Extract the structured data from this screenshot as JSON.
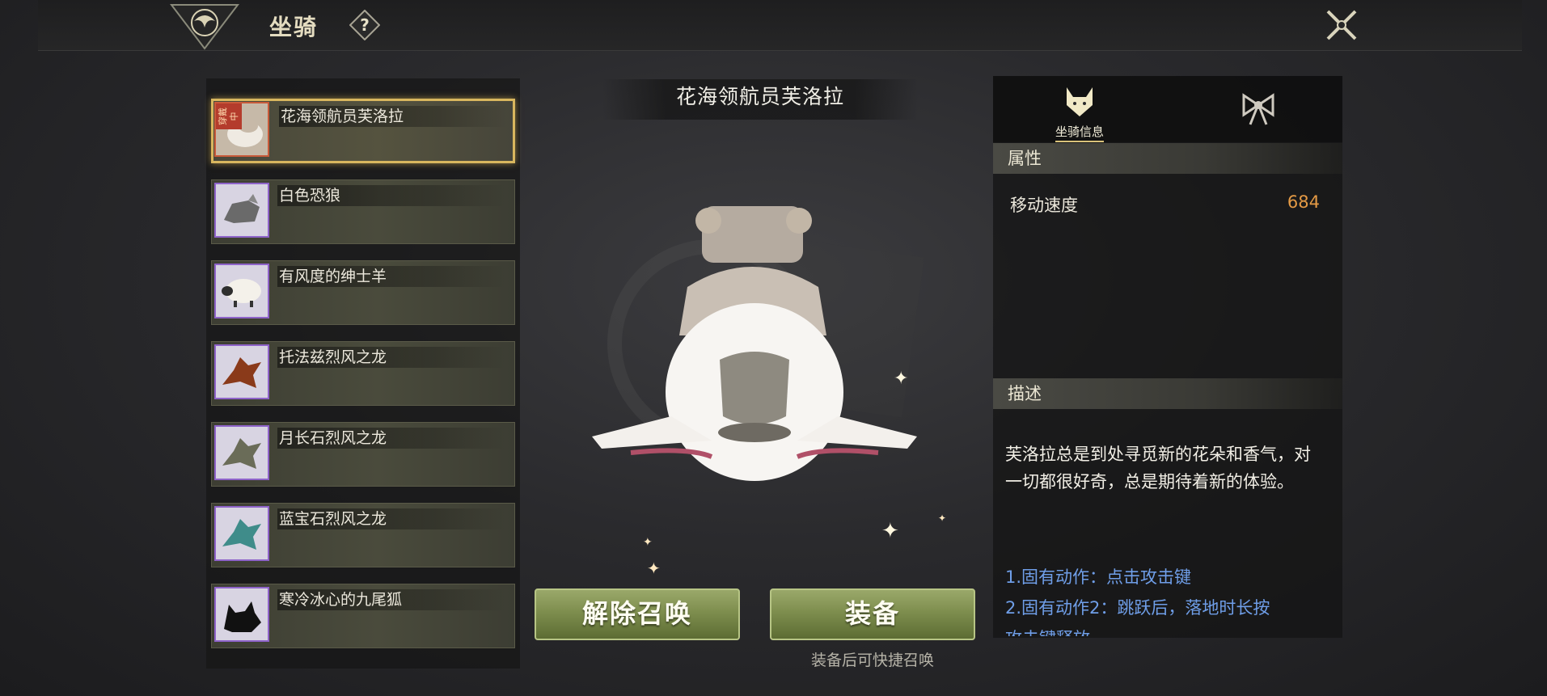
{
  "header": {
    "title": "坐骑",
    "help_icon": "question-icon",
    "close_icon": "close-icon"
  },
  "mount_list": [
    {
      "name": "花海领航员芙洛拉",
      "selected": true,
      "badge": "穿戴中",
      "frame_color": "#c85a3a"
    },
    {
      "name": "白色恐狼",
      "selected": false,
      "frame_color": "#8e63c9"
    },
    {
      "name": "有风度的绅士羊",
      "selected": false,
      "frame_color": "#8e63c9"
    },
    {
      "name": "托法兹烈风之龙",
      "selected": false,
      "frame_color": "#8e63c9"
    },
    {
      "name": "月长石烈风之龙",
      "selected": false,
      "frame_color": "#8e63c9"
    },
    {
      "name": "蓝宝石烈风之龙",
      "selected": false,
      "frame_color": "#8e63c9"
    },
    {
      "name": "寒冷冰心的九尾狐",
      "selected": false,
      "frame_color": "#8e63c9"
    }
  ],
  "preview": {
    "title": "花海领航员芙洛拉"
  },
  "actions": {
    "dismiss_label": "解除召唤",
    "equip_label": "装备",
    "hint": "装备后可快捷召唤"
  },
  "info_panel": {
    "tab_info_label": "坐骑信息",
    "attributes_header": "属性",
    "attributes": [
      {
        "name": "移动速度",
        "value": "684"
      }
    ],
    "description_header": "描述",
    "description": "芙洛拉总是到处寻觅新的花朵和香气，对一切都很好奇，总是期待着新的体验。",
    "skills": [
      "1.固有动作：点击攻击键",
      "2.固有动作2：跳跃后，落地时长按",
      "攻击键释放"
    ]
  },
  "colors": {
    "accent_gold": "#d8b65e",
    "value_orange": "#e49a45",
    "skill_blue": "#6f9ee8",
    "button_green": "#7e8e4e"
  }
}
